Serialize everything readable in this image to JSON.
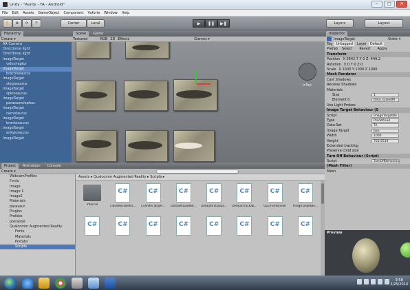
{
  "window": {
    "title": "Unity - \"Aunty - TA - Android\"",
    "minimize": "−",
    "maximize": "□",
    "close": "✕"
  },
  "menu": [
    "File",
    "Edit",
    "Assets",
    "GameObject",
    "Component",
    "Vuforia",
    "Window",
    "Help"
  ],
  "toolbar": {
    "pivot_label": "Center",
    "space_label": "Local",
    "play_icon": "▶",
    "pause_icon": "❚❚",
    "step_icon": "▶❚",
    "layers_label": "Layers",
    "layout_label": "Layout"
  },
  "hierarchy": {
    "tab_label": "Hierarchy",
    "create_label": "Create ▾",
    "items": [
      "AR Camera",
      "Directional light",
      "Directional light",
      "ImageTarget",
      "velociraptor",
      "ImageTarget",
      "brachiosaurus",
      "ImageTarget",
      "stegosaurus",
      "ImageTarget",
      "spinosaurus",
      "ImageTarget",
      "parasaurolophus",
      "ImageTarget",
      "carnotaurus",
      "ImageTarget",
      "brontosaurus",
      "ImageTarget",
      "ankylosaurus",
      "ImageTarget"
    ]
  },
  "scene": {
    "tab_scene": "Scene",
    "tab_game": "Game",
    "shading": "Textured",
    "render_mode": "RGB",
    "mode_2d": "2D",
    "effects": "Effects",
    "gizmos": "Gizmos ▾",
    "persp_label": "≡Top"
  },
  "inspector": {
    "tab_label": "Inspector",
    "object_name": "ImageTarget",
    "static_label": "Static ▾",
    "tag_label": "Tag",
    "tag_value": "Untagged",
    "layer_label": "Layer",
    "layer_value": "Default",
    "prefab_label": "Prefab",
    "prefab_select": "Select",
    "prefab_revert": "Revert",
    "prefab_apply": "Apply",
    "transform_title": "Transform",
    "position_label": "Position",
    "position_value": "X 3642.7  Y 0     Z -449.2",
    "rotation_label": "Rotation",
    "rotation_value": "X 0     Y 0     Z 0",
    "scale_label": "Scale",
    "scale_value": "X 1000  Y 1000  Z 1000",
    "mesh_renderer_title": "Mesh Renderer",
    "cast_shadows": "Cast Shadows",
    "receive_shadows": "Receive Shadows",
    "materials": "Materials",
    "size_label": "Size",
    "size_value": "1",
    "element_label": "Element 0",
    "element_value": "Dino_scaledM",
    "light_probes": "Use Light Probes",
    "itb_title": "Image Target Behaviour (S",
    "script_label": "Script",
    "script_value": "ImageTargetBe",
    "type_label": "Type",
    "type_value": "Predefined",
    "dataset_label": "Data Set",
    "dataset_value": "TA",
    "image_target_label": "Image Target",
    "image_target_value": "bau",
    "width_label": "Width",
    "width_value": "1000",
    "height_label": "Height",
    "height_value": "763.5519",
    "ext_tracking": "Extended tracking",
    "preserve_child": "Preserve child size",
    "turnoff_title": "Turn Off Behaviour (Script)",
    "script2_value": "TurnOffBehaviou",
    "meshfilter_title": "(Mesh Filter)",
    "mesh_label": "Mesh"
  },
  "preview": {
    "label": "Preview"
  },
  "project": {
    "tab_project": "Project",
    "tab_animation": "Animation",
    "tab_console": "Console",
    "create_label": "Create ▾",
    "tree": [
      "WebcamProfiles",
      "Fonts",
      "Image",
      "Image 1",
      "Image2",
      "Materials",
      "parasaur",
      "Plugins",
      "Prefabs",
      "pteranod",
      "Qualcomm Augmented Reality",
      "Fonts",
      "Materials",
      "Prefabs",
      "Scripts"
    ],
    "breadcrumb": "Assets ▸ Qualcomm Augmented Reality ▸ Scripts ▸",
    "assets": [
      "Internal",
      "CloudRecoBeha...",
      "CylinderTarget...",
      "DataSetLoadBe...",
      "DefaultInitializa...",
      "DefaultTrackab...",
      "GLErrorHandler",
      "ImageTargetBe...",
      "",
      "",
      "",
      "",
      "",
      "",
      "",
      ""
    ]
  },
  "taskbar": {
    "clock_time": "9:58",
    "clock_date": "2/25/2014"
  },
  "colors": {
    "hierarchy_bg": "#3f6594",
    "selection": "#5a86c3",
    "panel_bg": "#c4c4c4"
  }
}
